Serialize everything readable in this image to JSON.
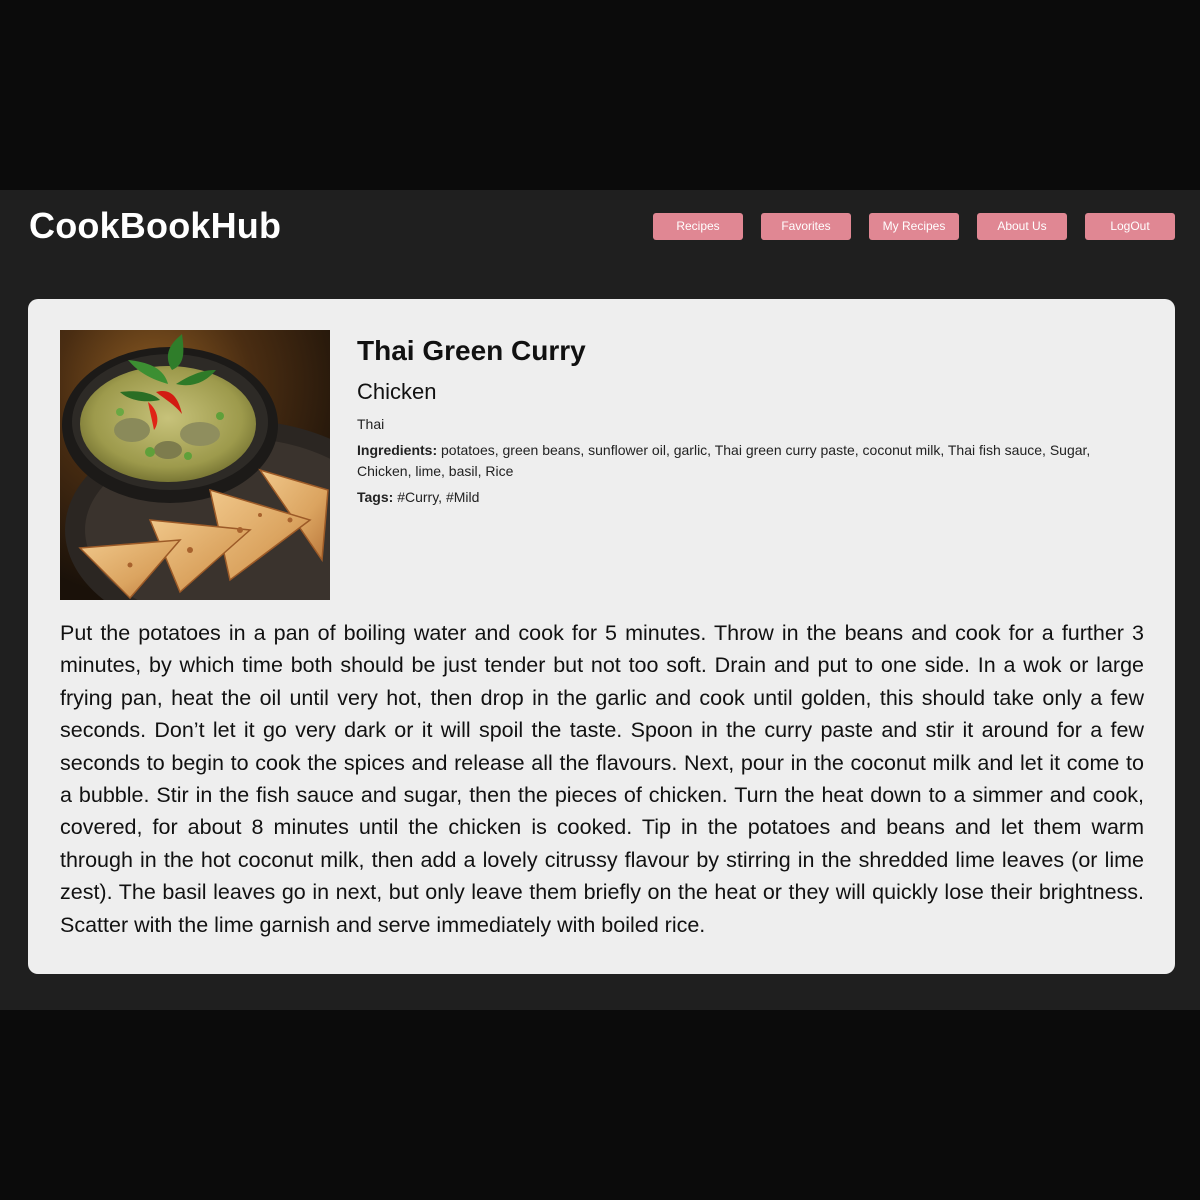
{
  "header": {
    "brand": "CookBookHub",
    "nav": [
      {
        "label": "Recipes"
      },
      {
        "label": "Favorites"
      },
      {
        "label": "My Recipes"
      },
      {
        "label": "About Us"
      },
      {
        "label": "LogOut"
      }
    ]
  },
  "recipe": {
    "title": "Thai Green Curry",
    "category": "Chicken",
    "cuisine": "Thai",
    "ingredients_label": "Ingredients:",
    "ingredients": "potatoes, green beans, sunflower oil, garlic, Thai green curry paste, coconut milk, Thai fish sauce, Sugar, Chicken, lime, basil, Rice",
    "tags_label": "Tags:",
    "tags": "#Curry, #Mild",
    "image": "thai-green-curry-photo",
    "method": "Put the potatoes in a pan of boiling water and cook for 5 minutes. Throw in the beans and cook for a further 3 minutes, by which time both should be just tender but not too soft. Drain and put to one side. In a wok or large frying pan, heat the oil until very hot, then drop in the garlic and cook until golden, this should take only a few seconds. Don’t let it go very dark or it will spoil the taste. Spoon in the curry paste and stir it around for a few seconds to begin to cook the spices and release all the flavours. Next, pour in the coconut milk and let it come to a bubble. Stir in the fish sauce and sugar, then the pieces of chicken. Turn the heat down to a simmer and cook, covered, for about 8 minutes until the chicken is cooked. Tip in the potatoes and beans and let them warm through in the hot coconut milk, then add a lovely citrussy flavour by stirring in the shredded lime leaves (or lime zest). The basil leaves go in next, but only leave them briefly on the heat or they will quickly lose their brightness. Scatter with the lime garnish and serve immediately with boiled rice."
  },
  "colors": {
    "page_bg": "#0b0b0b",
    "app_bg": "#1f1f1f",
    "card_bg": "#eeeeee",
    "nav_button": "#e08793"
  }
}
